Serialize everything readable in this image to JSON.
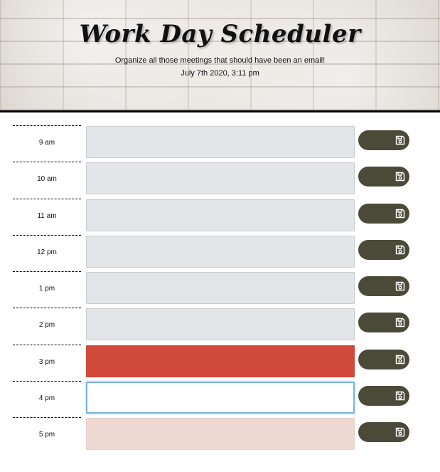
{
  "header": {
    "title": "Work Day Scheduler",
    "lead": "Organize all those meetings that should have been an email!",
    "current_date": "July 7th 2020, 3:11 pm"
  },
  "colors": {
    "past": "#e3e6e9",
    "present": "#d1493a",
    "future": "#efdad3",
    "save_button": "#4b4a38"
  },
  "save_icon": "floppy-disk-icon",
  "rows": [
    {
      "hour": "9 am",
      "text": "",
      "state": "past"
    },
    {
      "hour": "10 am",
      "text": "",
      "state": "past"
    },
    {
      "hour": "11 am",
      "text": "",
      "state": "past"
    },
    {
      "hour": "12 pm",
      "text": "",
      "state": "past"
    },
    {
      "hour": "1 pm",
      "text": "",
      "state": "past"
    },
    {
      "hour": "2 pm",
      "text": "",
      "state": "past"
    },
    {
      "hour": "3 pm",
      "text": "",
      "state": "present"
    },
    {
      "hour": "4 pm",
      "text": "",
      "state": "future-focused"
    },
    {
      "hour": "5 pm",
      "text": "",
      "state": "future"
    }
  ]
}
